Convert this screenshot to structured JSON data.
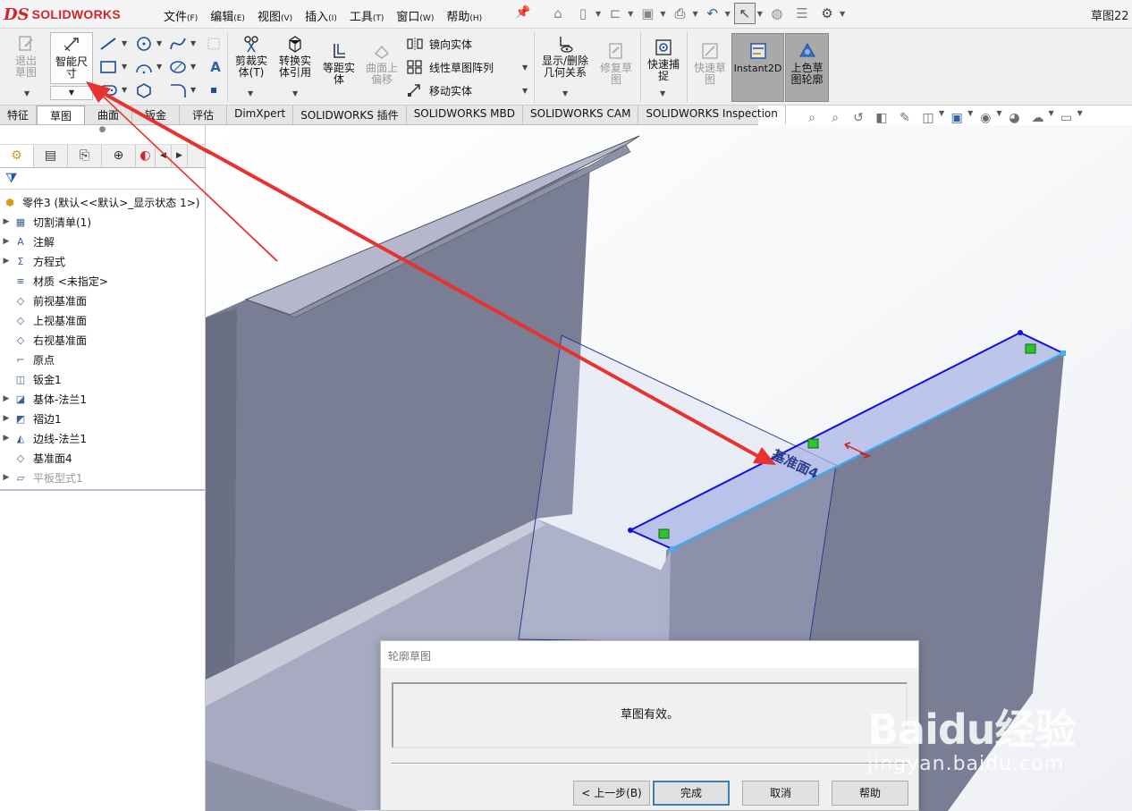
{
  "app": {
    "logo_prefix": "DS",
    "logo_text": "SOLIDWORKS",
    "document_title": "草图22"
  },
  "menu": [
    {
      "label": "文件",
      "key": "(F)"
    },
    {
      "label": "编辑",
      "key": "(E)"
    },
    {
      "label": "视图",
      "key": "(V)"
    },
    {
      "label": "插入",
      "key": "(I)"
    },
    {
      "label": "工具",
      "key": "(T)"
    },
    {
      "label": "窗口",
      "key": "(W)"
    },
    {
      "label": "帮助",
      "key": "(H)"
    }
  ],
  "ribbon": {
    "exit_sketch": "退出草图",
    "smart_dimension": "智能尺寸",
    "trim_entities": "剪裁实体",
    "trim_key": "(T)",
    "convert_entities": "转换实体引用",
    "offset_entities": "等距实体",
    "offset_on_surface": "曲面上偏移",
    "mirror_entities": "镜向实体",
    "linear_pattern": "线性草图阵列",
    "move_entities": "移动实体",
    "display_delete_relations": "显示/删除几何关系",
    "repair_sketch": "修复草图",
    "quick_snaps": "快速捕捉",
    "rapid_sketch": "快速草图",
    "instant2d": "Instant2D",
    "shaded_sketch": "上色草图轮廓"
  },
  "tabs": [
    "特征",
    "草图",
    "曲面",
    "钣金",
    "评估",
    "DimXpert",
    "SOLIDWORKS 插件",
    "SOLIDWORKS MBD",
    "SOLIDWORKS CAM",
    "SOLIDWORKS Inspection"
  ],
  "active_tab": "草图",
  "tree": {
    "root": "零件3  (默认<<默认>_显示状态 1>)",
    "items": [
      {
        "label": "切割清单(1)",
        "icon": "cut-list-icon",
        "expandable": true,
        "dim": false
      },
      {
        "label": "注解",
        "icon": "annotation-icon",
        "expandable": true,
        "dim": false
      },
      {
        "label": "方程式",
        "icon": "equation-icon",
        "expandable": true,
        "dim": false
      },
      {
        "label": "材质 <未指定>",
        "icon": "material-icon",
        "expandable": false,
        "dim": false
      },
      {
        "label": "前视基准面",
        "icon": "plane-icon",
        "expandable": false,
        "dim": false
      },
      {
        "label": "上视基准面",
        "icon": "plane-icon",
        "expandable": false,
        "dim": false
      },
      {
        "label": "右视基准面",
        "icon": "plane-icon",
        "expandable": false,
        "dim": false
      },
      {
        "label": "原点",
        "icon": "origin-icon",
        "expandable": false,
        "dim": false
      },
      {
        "label": "钣金1",
        "icon": "sheet-metal-icon",
        "expandable": false,
        "dim": false
      },
      {
        "label": "基体-法兰1",
        "icon": "base-flange-icon",
        "expandable": true,
        "dim": false
      },
      {
        "label": "褶边1",
        "icon": "hem-icon",
        "expandable": true,
        "dim": false
      },
      {
        "label": "边线-法兰1",
        "icon": "edge-flange-icon",
        "expandable": true,
        "dim": false
      },
      {
        "label": "基准面4",
        "icon": "plane-icon",
        "expandable": false,
        "dim": false
      },
      {
        "label": "平板型式1",
        "icon": "flat-pattern-icon",
        "expandable": true,
        "dim": true
      }
    ]
  },
  "viewport": {
    "plane_label": "基准面4"
  },
  "dialog": {
    "title": "轮廓草图",
    "message": "草图有效。",
    "back_button": "< 上一步(B)",
    "finish_button": "完成",
    "cancel_button": "取消",
    "help_button": "帮助"
  },
  "watermark": {
    "brand": "Baidu经验",
    "url": "jingyan.baidu.com"
  },
  "colors": {
    "brand_red": "#d0262b",
    "sketch_blue": "#1010e0",
    "arrow_red": "#e8322f",
    "model_dark": "#7a7e94",
    "model_light": "#b3b6cc"
  }
}
